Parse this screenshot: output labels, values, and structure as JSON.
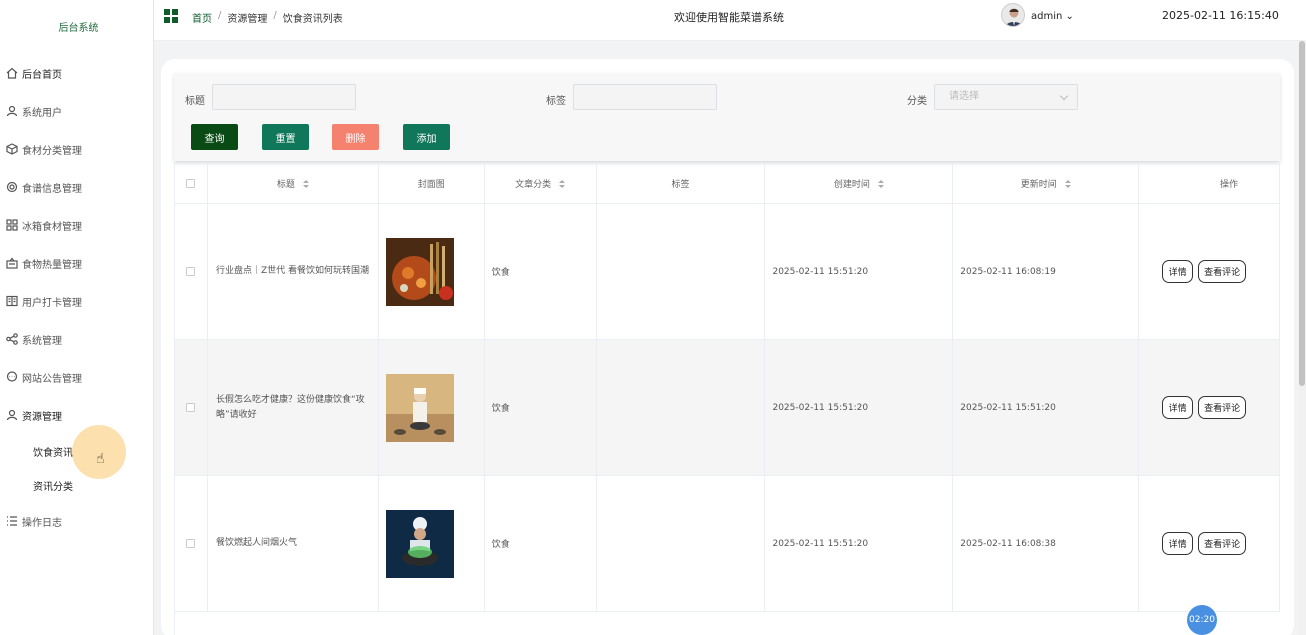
{
  "app": {
    "brand": "后台系统",
    "welcome": "欢迎使用智能菜谱系统",
    "user": "admin",
    "datetime": "2025-02-11 16:15:40"
  },
  "breadcrumb": {
    "home": "首页",
    "level2": "资源管理",
    "level3": "饮食资讯列表",
    "sep": "/"
  },
  "sidebar": {
    "items": [
      {
        "label": "后台首页",
        "icon": "home-icon"
      },
      {
        "label": "系统用户",
        "icon": "user-icon"
      },
      {
        "label": "食材分类管理",
        "icon": "box-icon"
      },
      {
        "label": "食谱信息管理",
        "icon": "gear-icon"
      },
      {
        "label": "冰箱食材管理",
        "icon": "grid-icon"
      },
      {
        "label": "食物热量管理",
        "icon": "scale-icon"
      },
      {
        "label": "用户打卡管理",
        "icon": "book-icon"
      },
      {
        "label": "系统管理",
        "icon": "share-icon"
      },
      {
        "label": "网站公告管理",
        "icon": "chat-icon"
      },
      {
        "label": "资源管理",
        "icon": "user-icon"
      },
      {
        "label": "操作日志",
        "icon": "list-icon"
      }
    ],
    "subitems": [
      {
        "label": "饮食资讯"
      },
      {
        "label": "资讯分类"
      }
    ]
  },
  "search": {
    "title_label": "标题",
    "tag_label": "标签",
    "category_label": "分类",
    "category_placeholder": "请选择",
    "buttons": {
      "query": "查询",
      "reset": "重置",
      "delete": "删除",
      "add": "添加"
    }
  },
  "colors": {
    "query": "#0a4a15",
    "reset": "#10775a",
    "delete": "#f5826f",
    "add": "#10775a",
    "accent": "#0e5b2c"
  },
  "table": {
    "headers": [
      "标题",
      "封面图",
      "文章分类",
      "标签",
      "创建时间",
      "更新时间",
      "操作"
    ],
    "rows": [
      {
        "title": "行业盘点｜Z世代 看餐饮如何玩转国潮",
        "category": "饮食",
        "tag": "",
        "created": "2025-02-11 15:51:20",
        "updated": "2025-02-11 16:08:19"
      },
      {
        "title": "长假怎么吃才健康？这份健康饮食“攻略”请收好",
        "category": "饮食",
        "tag": "",
        "created": "2025-02-11 15:51:20",
        "updated": "2025-02-11 15:51:20"
      },
      {
        "title": "餐饮燃起人间烟火气",
        "category": "饮食",
        "tag": "",
        "created": "2025-02-11 15:51:20",
        "updated": "2025-02-11 16:08:38"
      }
    ],
    "actions": {
      "detail": "详情",
      "comments": "查看评论"
    }
  },
  "timer": "02:20"
}
